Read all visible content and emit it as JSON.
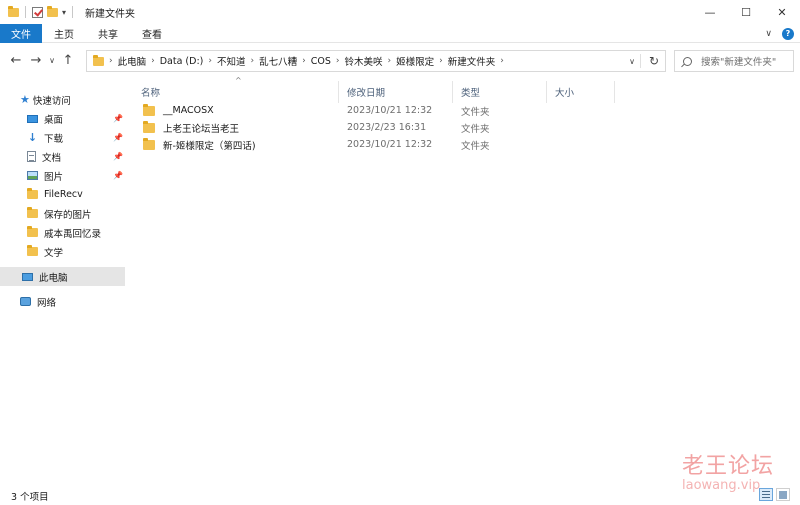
{
  "window": {
    "title": "新建文件夹",
    "controls": {
      "minimize": "—",
      "maximize": "☐",
      "close": "✕"
    }
  },
  "ribbon": {
    "tabs": [
      {
        "label": "文件",
        "active": true
      },
      {
        "label": "主页"
      },
      {
        "label": "共享"
      },
      {
        "label": "查看"
      }
    ],
    "accent_color": "#1979ca"
  },
  "address": {
    "crumbs": [
      "此电脑",
      "Data (D:)",
      "不知道",
      "乱七八糟",
      "COS",
      "铃木美咲",
      "姬様限定",
      "新建文件夹"
    ]
  },
  "search": {
    "placeholder": "搜索\"新建文件夹\""
  },
  "sidebar": {
    "items": [
      {
        "label": "快速访问",
        "icon": "star-icon"
      },
      {
        "label": "桌面",
        "icon": "desktop-icon",
        "pinned": true
      },
      {
        "label": "下载",
        "icon": "download-icon",
        "pinned": true
      },
      {
        "label": "文档",
        "icon": "document-icon",
        "pinned": true
      },
      {
        "label": "图片",
        "icon": "picture-icon",
        "pinned": true
      },
      {
        "label": "FileRecv",
        "icon": "folder-icon"
      },
      {
        "label": "保存的图片",
        "icon": "folder-icon"
      },
      {
        "label": "戚本禹回忆录",
        "icon": "folder-icon"
      },
      {
        "label": "文学",
        "icon": "folder-icon"
      },
      {
        "label": "此电脑",
        "icon": "computer-icon",
        "selected": true
      },
      {
        "label": "网络",
        "icon": "network-icon"
      }
    ]
  },
  "columns": {
    "name": "名称",
    "date": "修改日期",
    "type": "类型",
    "size": "大小"
  },
  "files": [
    {
      "name": "__MACOSX",
      "date": "2023/10/21 12:32",
      "type": "文件夹"
    },
    {
      "name": "上老王论坛当老王",
      "date": "2023/2/23 16:31",
      "type": "文件夹"
    },
    {
      "name": "新-姬様限定（第四话)",
      "date": "2023/10/21 12:32",
      "type": "文件夹"
    }
  ],
  "status": {
    "item_count": "3 个项目"
  },
  "watermark": {
    "line1": "老王论坛",
    "line2": "laowang.vip"
  }
}
